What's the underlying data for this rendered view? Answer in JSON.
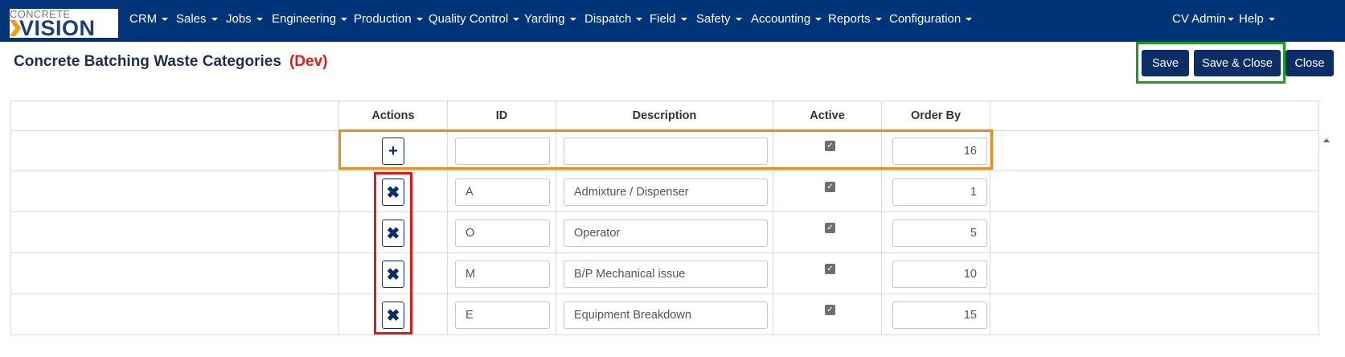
{
  "app": {
    "logo_top": "CONCRETE",
    "logo_bottom": "VISION"
  },
  "nav": {
    "menus": [
      "CRM",
      "Sales",
      "Jobs",
      "Engineering",
      "Production",
      "Quality Control",
      "Yarding",
      "Dispatch",
      "Field",
      "Safety",
      "Accounting",
      "Reports",
      "Configuration"
    ],
    "user": "CV Admin",
    "help": "Help"
  },
  "page": {
    "title": "Concrete Batching Waste Categories",
    "env_tag": "(Dev)"
  },
  "toolbar": {
    "save_label": "Save",
    "save_close_label": "Save & Close",
    "close_label": "Close"
  },
  "grid": {
    "columns": [
      "Actions",
      "ID",
      "Description",
      "Active",
      "Order By"
    ],
    "new_row": {
      "id": "",
      "description": "",
      "active": true,
      "order_by": "16"
    },
    "rows": [
      {
        "id": "A",
        "description": "Admixture / Dispenser",
        "active": true,
        "order_by": "1"
      },
      {
        "id": "O",
        "description": "Operator",
        "active": true,
        "order_by": "5"
      },
      {
        "id": "M",
        "description": "B/P Mechanical issue",
        "active": true,
        "order_by": "10"
      },
      {
        "id": "E",
        "description": "Equipment Breakdown",
        "active": true,
        "order_by": "15"
      }
    ]
  },
  "icons": {
    "add": "plus-icon",
    "delete": "times-icon",
    "checkbox": "check-icon"
  },
  "colors": {
    "navbar": "#003479",
    "button": "#0c2e68",
    "title": "#1f2d52",
    "dev_tag": "#e21a1a",
    "highlight_save": "#18a11a",
    "highlight_new_row": "#f08a1a",
    "highlight_delete": "#e01919"
  }
}
